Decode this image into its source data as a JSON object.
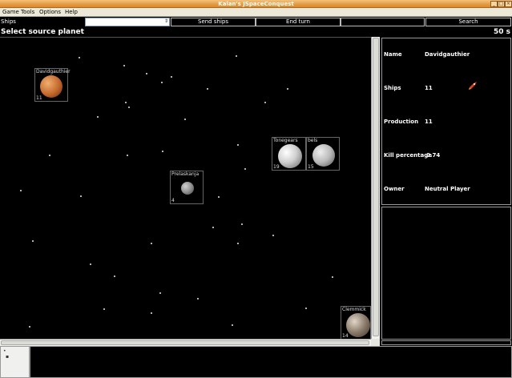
{
  "window": {
    "title": "Kalan's JSpaceConquest"
  },
  "menu": [
    "Game",
    "Tools",
    "Options",
    "Help"
  ],
  "toolbar": {
    "ships_label": "Ships",
    "ships_value": "",
    "send_label": "Send ships",
    "end_turn_label": "End turn",
    "search_label": "Search"
  },
  "status": {
    "message": "Select source planet",
    "timer": "50 s"
  },
  "planets": [
    {
      "name": "Davidgauthier",
      "ships": "11",
      "color": "#c4682c"
    },
    {
      "name": "Tonegears",
      "ships": "19",
      "color": "#d8d8d8"
    },
    {
      "name": "bels",
      "ships": "15",
      "color": "#b9b9b9"
    },
    {
      "name": "Prelaskanja",
      "ships": "4",
      "color": "#909090"
    },
    {
      "name": "Clemmick",
      "ships": "14",
      "color": "#8a7a6a"
    }
  ],
  "info": {
    "name_label": "Name",
    "name_value": "Davidgauthier",
    "ships_label": "Ships",
    "ships_value": "11",
    "production_label": "Production",
    "production_value": "11",
    "kill_label": "Kill percentage",
    "kill_value": "0.74",
    "owner_label": "Owner",
    "owner_value": "Neutral Player"
  }
}
